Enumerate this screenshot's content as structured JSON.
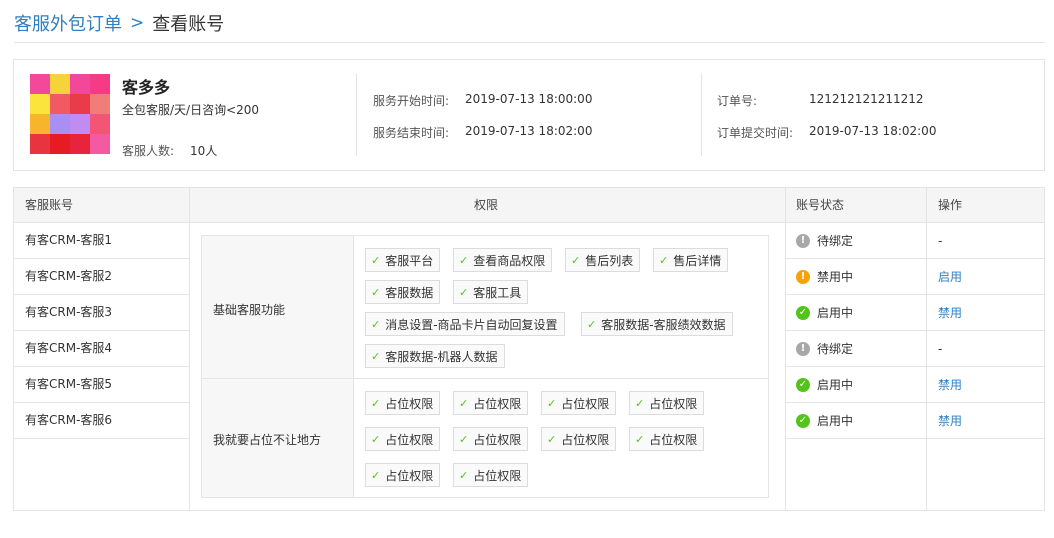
{
  "breadcrumb": {
    "parent": "客服外包订单",
    "separator": ">",
    "current": "查看账号"
  },
  "order": {
    "customer_name": "客多多",
    "package": "全包客服/天/日咨询<200",
    "staff_count_label": "客服人数:",
    "staff_count_value": "10人",
    "service_start_label": "服务开始时间:",
    "service_start_value": "2019-07-13 18:00:00",
    "service_end_label": "服务结束时间:",
    "service_end_value": "2019-07-13 18:02:00",
    "order_no_label": "订单号:",
    "order_no_value": "121212121211212",
    "submit_time_label": "订单提交时间:",
    "submit_time_value": "2019-07-13 18:02:00"
  },
  "avatar_colors": [
    "#f4489a",
    "#f8d23a",
    "#f2489c",
    "#f53b86",
    "#fbe43c",
    "#f25a62",
    "#ea3b4a",
    "#f07d7a",
    "#f6b52a",
    "#aa8ef4",
    "#c18cf2",
    "#f25674",
    "#e8343e",
    "#e71c22",
    "#e8243c",
    "#f35aa2"
  ],
  "table": {
    "headers": {
      "account": "客服账号",
      "permission": "权限",
      "status": "账号状态",
      "action": "操作"
    },
    "rows": [
      {
        "account": "有客CRM-客服1",
        "status": "待绑定",
        "status_icon": "!",
        "status_color": "#a8a8a8",
        "action": "-"
      },
      {
        "account": "有客CRM-客服2",
        "status": "禁用中",
        "status_icon": "!",
        "status_color": "#f5a20d",
        "action": "启用"
      },
      {
        "account": "有客CRM-客服3",
        "status": "启用中",
        "status_icon": "✓",
        "status_color": "#52c41a",
        "action": "禁用"
      },
      {
        "account": "有客CRM-客服4",
        "status": "待绑定",
        "status_icon": "!",
        "status_color": "#a8a8a8",
        "action": "-"
      },
      {
        "account": "有客CRM-客服5",
        "status": "启用中",
        "status_icon": "✓",
        "status_color": "#52c41a",
        "action": "禁用"
      },
      {
        "account": "有客CRM-客服6",
        "status": "启用中",
        "status_icon": "✓",
        "status_color": "#52c41a",
        "action": "禁用"
      }
    ]
  },
  "permission_groups": [
    {
      "name": "基础客服功能",
      "tags": [
        "客服平台",
        "查看商品权限",
        "售后列表",
        "售后详情",
        "客服数据",
        "客服工具",
        "消息设置-商品卡片自动回复设置",
        "客服数据-客服绩效数据",
        "客服数据-机器人数据"
      ]
    },
    {
      "name": "我就要占位不让地方",
      "tags": [
        "占位权限",
        "占位权限",
        "占位权限",
        "占位权限",
        "占位权限",
        "占位权限",
        "占位权限",
        "占位权限",
        "占位权限",
        "占位权限"
      ]
    }
  ],
  "check_icon_color": "#52c41a",
  "link_color": "#2f7fc2"
}
